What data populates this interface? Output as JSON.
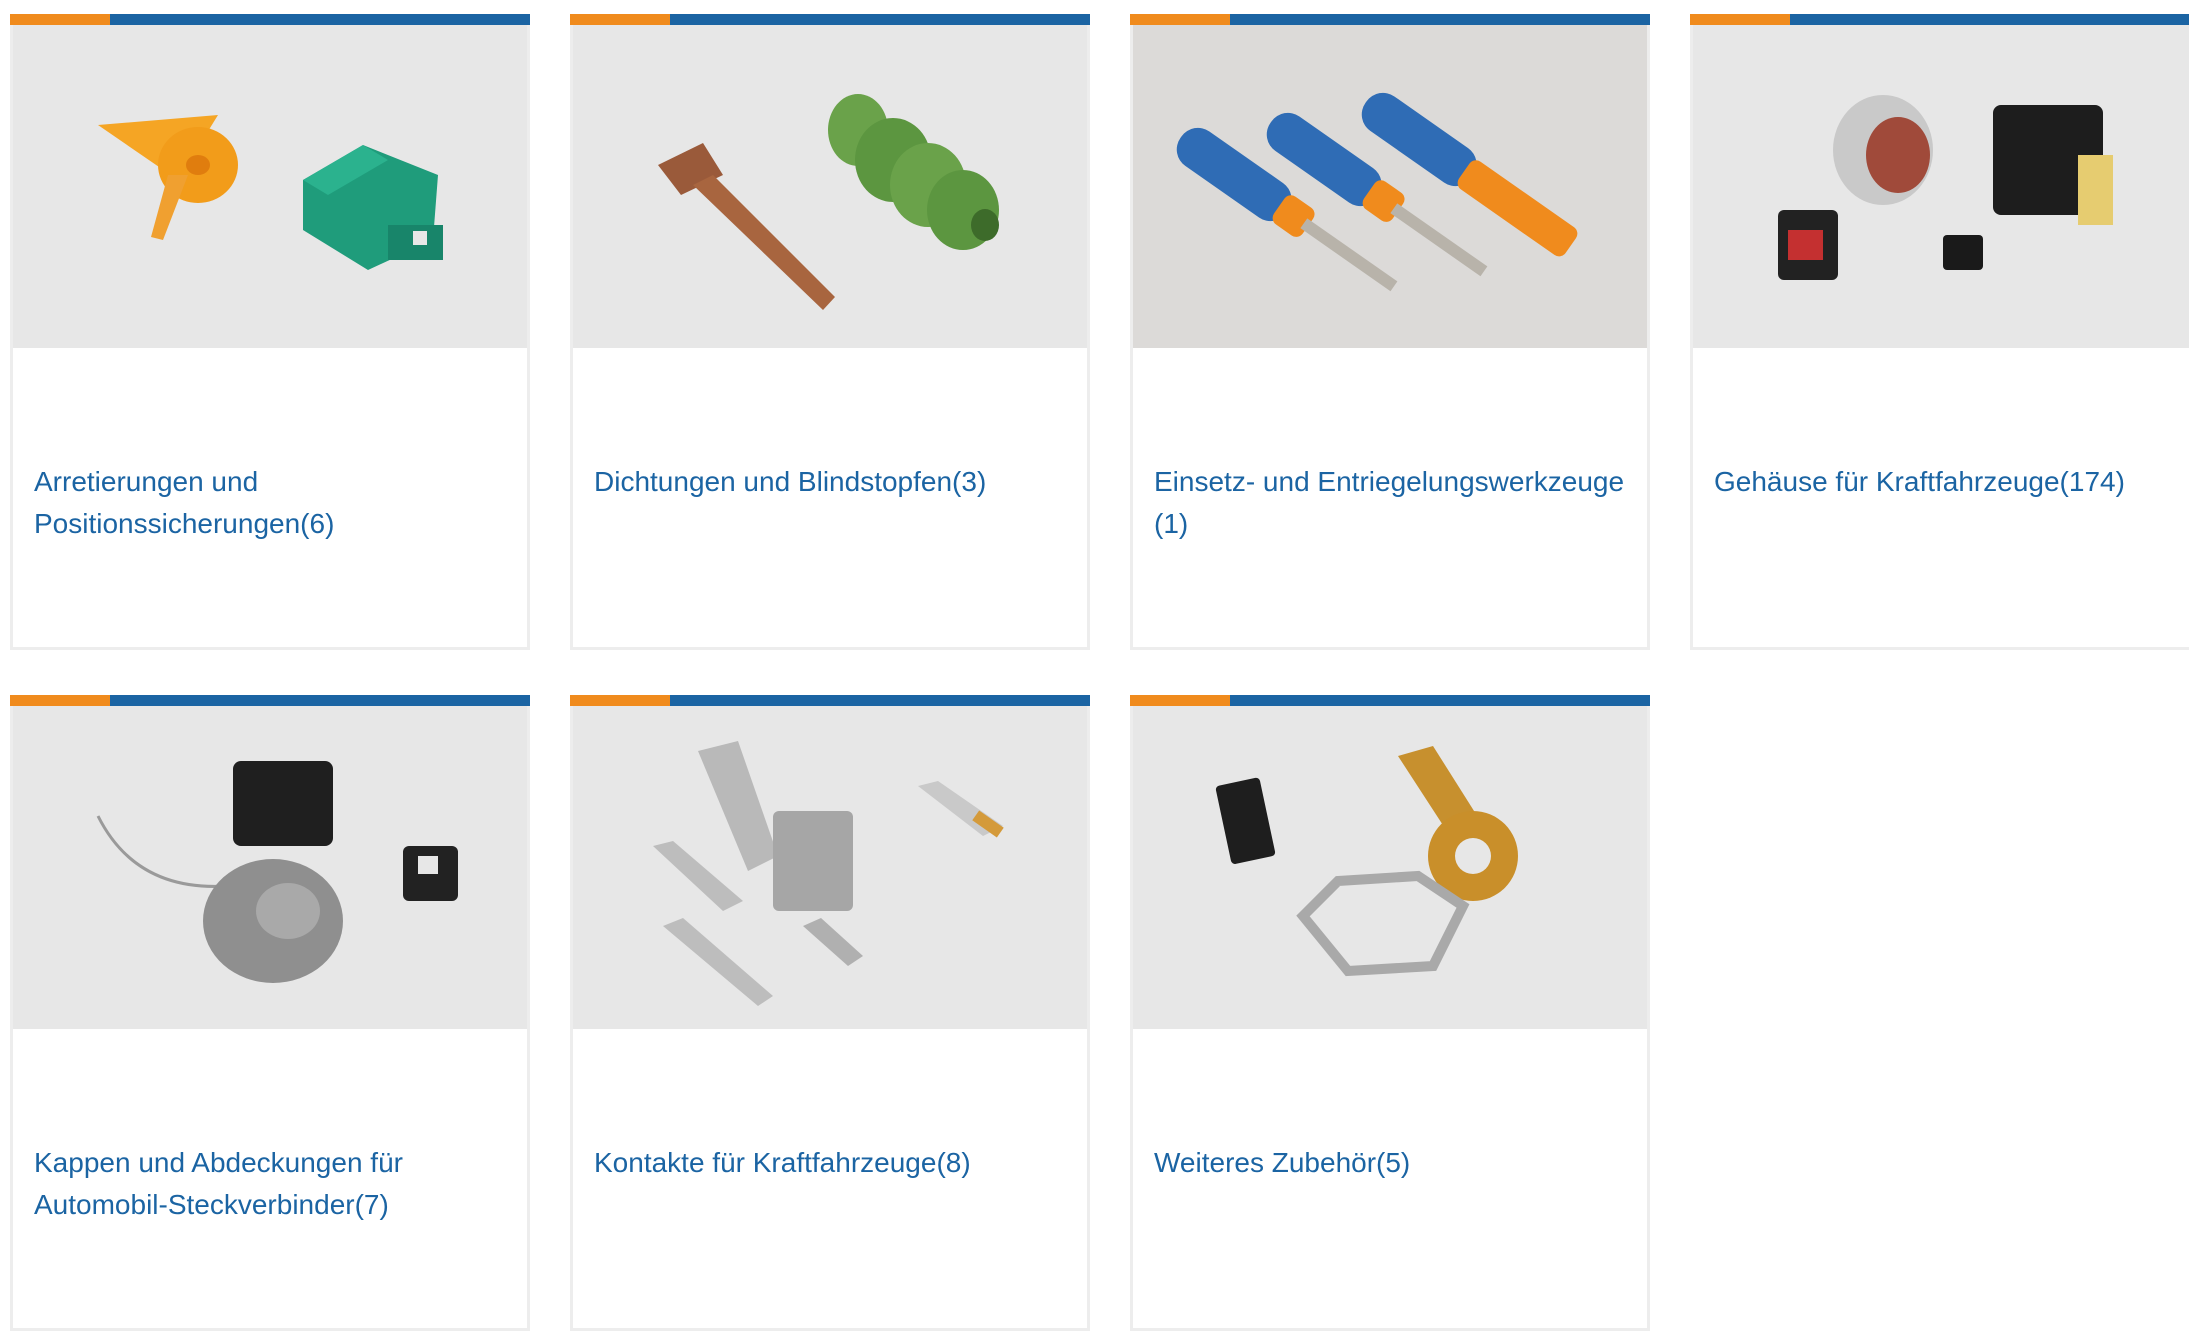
{
  "brand_colors": {
    "accent_orange": "#f08b1d",
    "accent_blue": "#1b64a3",
    "link_blue": "#1b64a3",
    "card_border": "#ededed",
    "image_bg": "#e6e6e6"
  },
  "categories": [
    {
      "name": "Arretierungen und Positionssicherungen",
      "count": "(6)",
      "image_icon": "wedgelock-tpa-image"
    },
    {
      "name": "Dichtungen und Blindstopfen",
      "count": "(3)",
      "image_icon": "seal-plug-image"
    },
    {
      "name": "Einsetz- und Entriegelungswerkzeuge ",
      "count": "(1)",
      "image_icon": "removal-tools-image"
    },
    {
      "name": "Gehäuse für Kraftfahrzeuge",
      "count": "(174)",
      "image_icon": "connector-housings-image"
    },
    {
      "name": "Kappen und Abdeckungen für Automobil-Steckverbinder",
      "count": "(7)",
      "image_icon": "caps-covers-image"
    },
    {
      "name": "Kontakte für Kraftfahrzeuge",
      "count": "(8)",
      "image_icon": "terminals-contacts-image"
    },
    {
      "name": "Weiteres Zubehör",
      "count": "(5)",
      "image_icon": "accessories-image"
    }
  ]
}
